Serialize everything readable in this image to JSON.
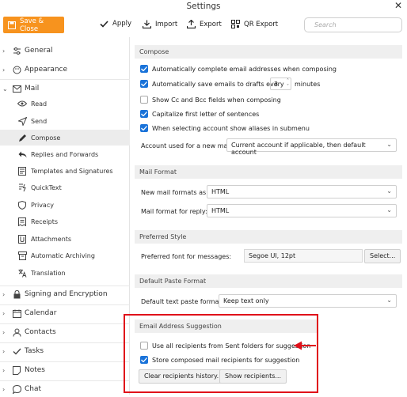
{
  "window": {
    "title": "Settings",
    "close_glyph": "✕"
  },
  "toolbar": {
    "save_close": "Save & Close",
    "apply": "Apply",
    "import": "Import",
    "export": "Export",
    "qr_export": "QR Export",
    "search_placeholder": "Search"
  },
  "sidebar": {
    "general": "General",
    "appearance": "Appearance",
    "mail": "Mail",
    "mail_items": [
      "Read",
      "Send",
      "Compose",
      "Replies and Forwards",
      "Templates and Signatures",
      "QuickText",
      "Privacy",
      "Receipts",
      "Attachments",
      "Automatic Archiving",
      "Translation"
    ],
    "signing": "Signing and Encryption",
    "calendar": "Calendar",
    "contacts": "Contacts",
    "tasks": "Tasks",
    "notes": "Notes",
    "chat": "Chat"
  },
  "compose": {
    "header": "Compose",
    "opt1": "Automatically complete email addresses when composing",
    "opt2a": "Automatically save emails to drafts every",
    "opt2_value": "3",
    "opt2b": "minutes",
    "opt3": "Show Cc and Bcc fields when composing",
    "opt4": "Capitalize first letter of sentences",
    "opt5": "When selecting account show aliases in submenu",
    "account_label": "Account used for a new mail",
    "account_value": "Current account if applicable, then default account"
  },
  "mail_format": {
    "header": "Mail Format",
    "new_label": "New mail formats as:",
    "new_value": "HTML",
    "reply_label": "Mail format for reply:",
    "reply_value": "HTML"
  },
  "preferred_style": {
    "header": "Preferred Style",
    "font_label": "Preferred font for messages:",
    "font_value": "Segoe UI, 12pt",
    "select_button": "Select..."
  },
  "paste": {
    "header": "Default Paste Format",
    "label": "Default text paste format:",
    "value": "Keep text only"
  },
  "suggestion": {
    "header": "Email Address Suggestion",
    "opt1": "Use all recipients from Sent folders for suggestion",
    "opt2": "Store composed mail recipients for suggestion",
    "clear_button": "Clear recipients history...",
    "show_button": "Show recipients..."
  },
  "colors": {
    "accent": "#f7931e",
    "checkbox": "#1a73d9",
    "highlight": "#e0101a"
  }
}
